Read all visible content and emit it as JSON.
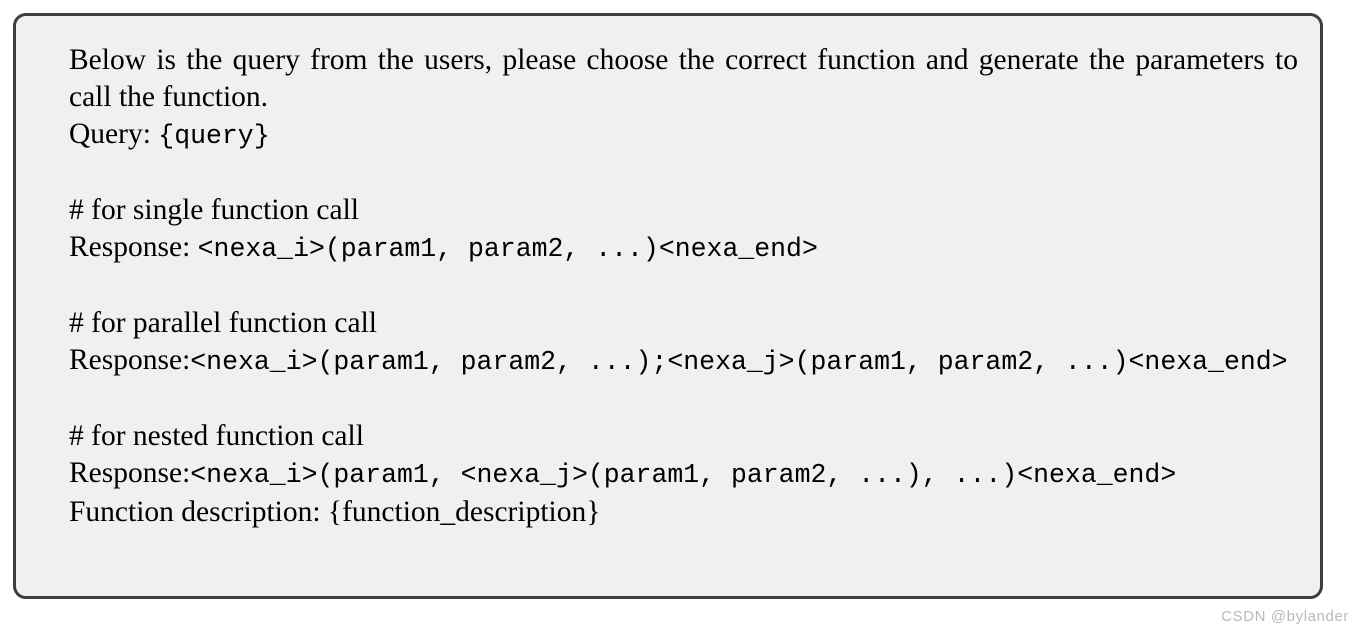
{
  "card": {
    "background_color": "#f0f0f0",
    "border_color": "#3d3d3d",
    "text_color": "#000000"
  },
  "prompt": {
    "intro_line": "Below is the query from the users, please choose the correct function and generate the parameters to call the function.",
    "query_label": "Query:",
    "query_placeholder": "{query}",
    "sections": [
      {
        "comment": "# for single function call",
        "response_label": "Response: ",
        "response_template": "<nexa_i>(param1, param2, ...)<nexa_end>"
      },
      {
        "comment": "# for parallel function call",
        "response_label": "Response:",
        "response_template": "<nexa_i>(param1, param2, ...);<nexa_j>(param1, param2, ...)<nexa_end>"
      },
      {
        "comment": "# for nested function call",
        "response_label": "Response:",
        "response_template": "<nexa_i>(param1, <nexa_j>(param1, param2, ...), ...)<nexa_end>"
      }
    ],
    "function_description_label": "Function description:",
    "function_description_placeholder": "{function_description}"
  },
  "watermark": {
    "text": "CSDN @bylander"
  }
}
